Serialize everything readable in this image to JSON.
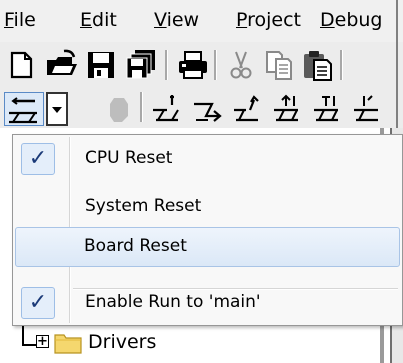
{
  "menubar": {
    "items": [
      {
        "mnemonic": "F",
        "rest": "ile"
      },
      {
        "mnemonic": "E",
        "rest": "dit"
      },
      {
        "mnemonic": "V",
        "rest": "iew"
      },
      {
        "mnemonic": "P",
        "rest": "roject"
      },
      {
        "mnemonic": "D",
        "rest": "ebug"
      }
    ]
  },
  "toolbar1": {
    "icons": [
      "new-file-icon",
      "open-folder-icon",
      "save-icon",
      "save-all-icon",
      "print-icon",
      "cut-icon",
      "copy-icon",
      "paste-icon"
    ]
  },
  "toolbar2": {
    "icons": [
      "reset-icon",
      "dropdown-arrow-icon",
      "stop-icon",
      "step-icon",
      "step-over-icon",
      "step-out-icon",
      "run-to-cursor-icon",
      "show-next-statement-icon"
    ]
  },
  "dropdown": {
    "items": [
      {
        "label": "CPU Reset",
        "checked": true,
        "highlighted": false
      },
      {
        "label": "System Reset",
        "checked": false,
        "highlighted": false
      },
      {
        "label": "Board Reset",
        "checked": false,
        "highlighted": true
      },
      {
        "label": "Enable Run to 'main'",
        "checked": true,
        "highlighted": false
      }
    ],
    "check_glyph": "✓"
  },
  "tree": {
    "expander_glyph": "+",
    "node_label": "Drivers"
  },
  "colors": {
    "highlight": "#dbe8f7",
    "check": "#1b3a78",
    "folder": "#f5d76e"
  }
}
